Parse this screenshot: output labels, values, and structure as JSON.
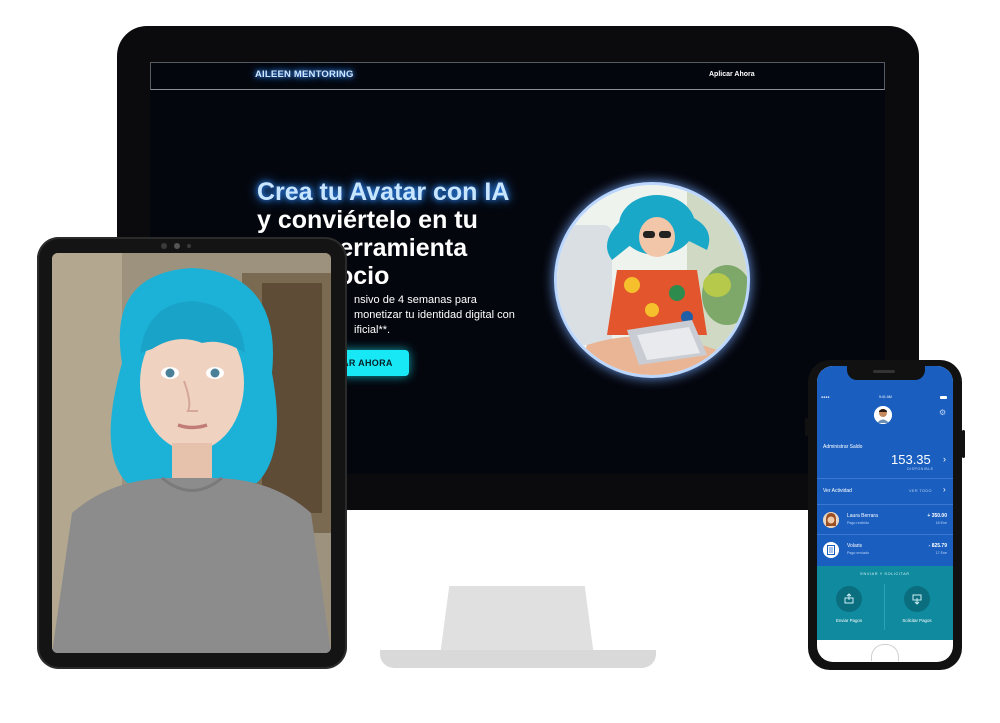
{
  "desktop": {
    "brand": "AILEEN MENTORING",
    "nav_apply": "Aplicar Ahora",
    "hero": {
      "title_line1": "Crea tu Avatar con IA",
      "title_line2": "y conviértelo en tu",
      "title_line3": "herramienta",
      "title_line4": "ocio",
      "desc_line1": "nsivo de 4 semanas para",
      "desc_line2": "monetizar tu identidad digital con",
      "desc_line3": "ificial**.",
      "cta": "ZAR AHORA"
    },
    "colors": {
      "accent": "#18e7f6",
      "glow": "#2f8cff",
      "screen_bg": "#04060d"
    }
  },
  "phone": {
    "status_time": "9:41 AM",
    "balance_label": "Administrar Saldo",
    "balance_amount": "153.35",
    "balance_sub": "DISPONIBLE",
    "activity_title": "Ver Actividad",
    "activity_all": "VER TODO",
    "transactions": [
      {
        "name": "Laura Berrara",
        "sub": "Pago recibido",
        "amount": "+ 350.00",
        "date": "18 Ene"
      },
      {
        "name": "Volaris",
        "sub": "Pago enviado",
        "amount": "- 825.79",
        "date": "17 Ene"
      }
    ],
    "pay_title": "ENVIAR Y SOLICITAR",
    "send_label": "Enviar Pagos",
    "request_label": "Solicitar Pagos",
    "colors": {
      "primary": "#1a5fc0",
      "teal": "#0f8a9e"
    }
  }
}
